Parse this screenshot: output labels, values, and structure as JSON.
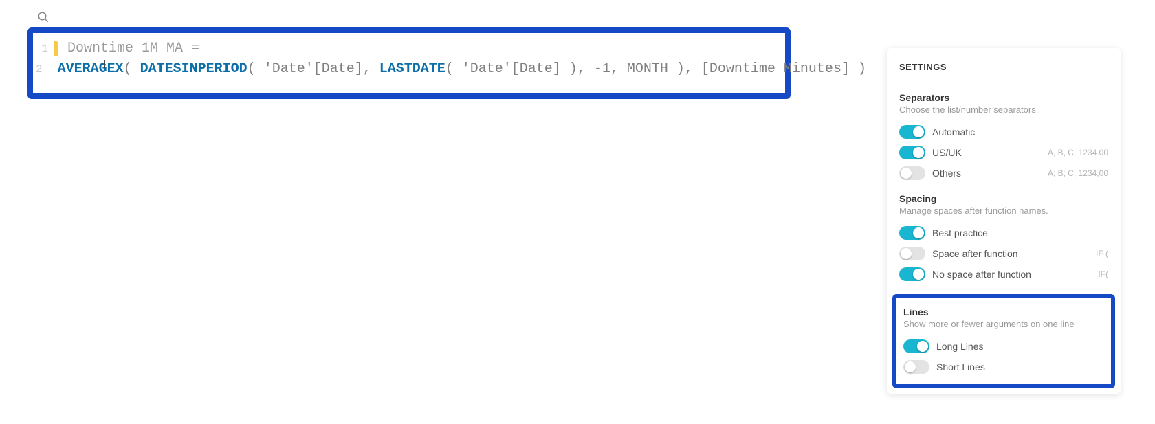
{
  "search": {
    "placeholder": ""
  },
  "code": {
    "lines": [
      {
        "n": "1"
      },
      {
        "n": "2"
      }
    ],
    "line1": {
      "measure": "Downtime 1M MA ="
    },
    "line2": {
      "fn1": "AVERAGEX",
      "p1": "( ",
      "fn2": "DATESINPERIOD",
      "p2": "( ",
      "str1": "'Date'[Date]",
      "c1": ", ",
      "fn3": "LASTDATE",
      "p3": "( ",
      "str2": "'Date'[Date]",
      "p4": " )",
      "c2": ", ",
      "num": "-1",
      "c3": ", ",
      "kw": "MONTH",
      "p5": " )",
      "c4": ", ",
      "meas": "[Downtime Minutes]",
      "p6": " )"
    }
  },
  "settings": {
    "title": "SETTINGS",
    "separators": {
      "title": "Separators",
      "desc": "Choose the list/number separators.",
      "auto": {
        "label": "Automatic",
        "on": true
      },
      "usuk": {
        "label": "US/UK",
        "hint": "A, B, C, 1234.00",
        "on": true
      },
      "others": {
        "label": "Others",
        "hint": "A; B; C; 1234,00",
        "on": false
      }
    },
    "spacing": {
      "title": "Spacing",
      "desc": "Manage spaces after function names.",
      "best": {
        "label": "Best practice",
        "on": true
      },
      "after": {
        "label": "Space after function",
        "hint": "IF (",
        "on": false
      },
      "noafter": {
        "label": "No space after function",
        "hint": "IF(",
        "on": true
      }
    },
    "lines": {
      "title": "Lines",
      "desc": "Show more or fewer arguments on one line",
      "long": {
        "label": "Long Lines",
        "on": true
      },
      "short": {
        "label": "Short Lines",
        "on": false
      }
    }
  }
}
